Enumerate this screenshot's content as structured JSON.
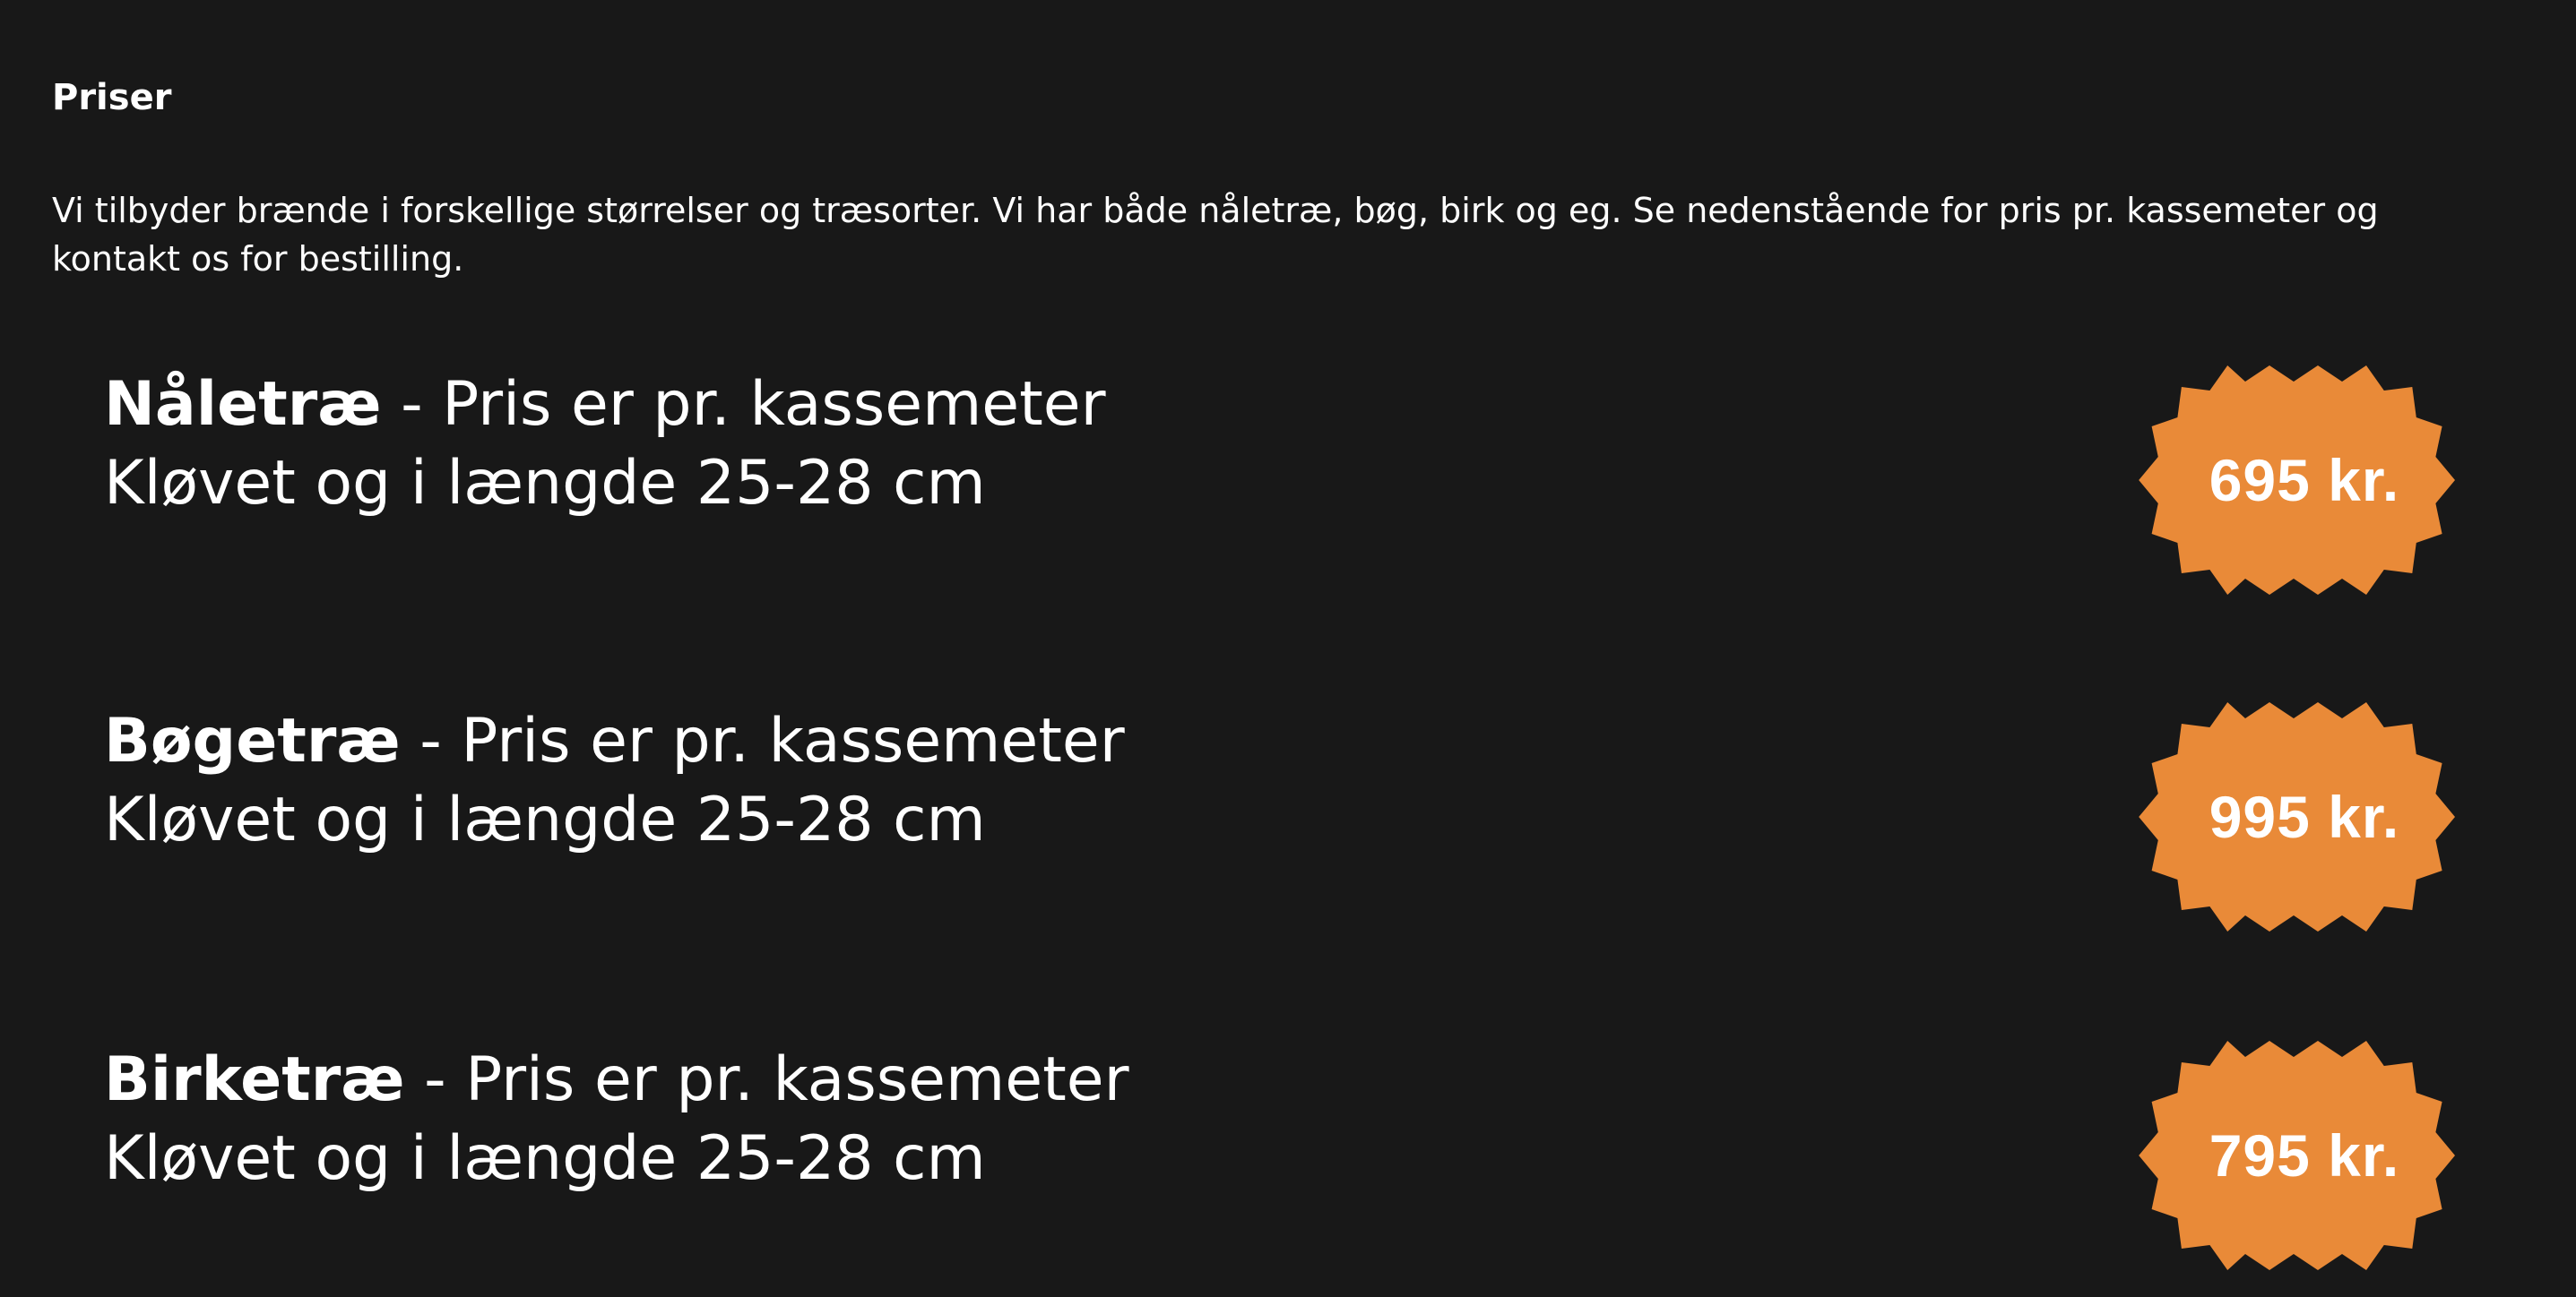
{
  "page": {
    "title": "Priser",
    "intro": "Vi tilbyder brænde i forskellige størrelser og træsorter. Vi har både nåletræ, bøg, birk og eg. Se nedenstående for pris pr. kassemeter og kontakt os for bestilling."
  },
  "prices": [
    {
      "name": "Nåletræ",
      "unit_text": " - Pris er pr. kassemeter",
      "detail": "Kløvet og i længde 25-28 cm",
      "price": "695 kr."
    },
    {
      "name": "Bøgetræ",
      "unit_text": " - Pris er pr. kassemeter",
      "detail": "Kløvet og i længde 25-28 cm",
      "price": "995 kr."
    },
    {
      "name": "Birketræ",
      "unit_text": " - Pris er pr. kassemeter",
      "detail": "Kløvet og i længde 25-28 cm",
      "price": "795 kr."
    }
  ],
  "colors": {
    "background": "#181818",
    "text": "#ffffff",
    "badge": "#e98a38"
  },
  "icons": {
    "badge": "starburst-price-badge-icon"
  }
}
